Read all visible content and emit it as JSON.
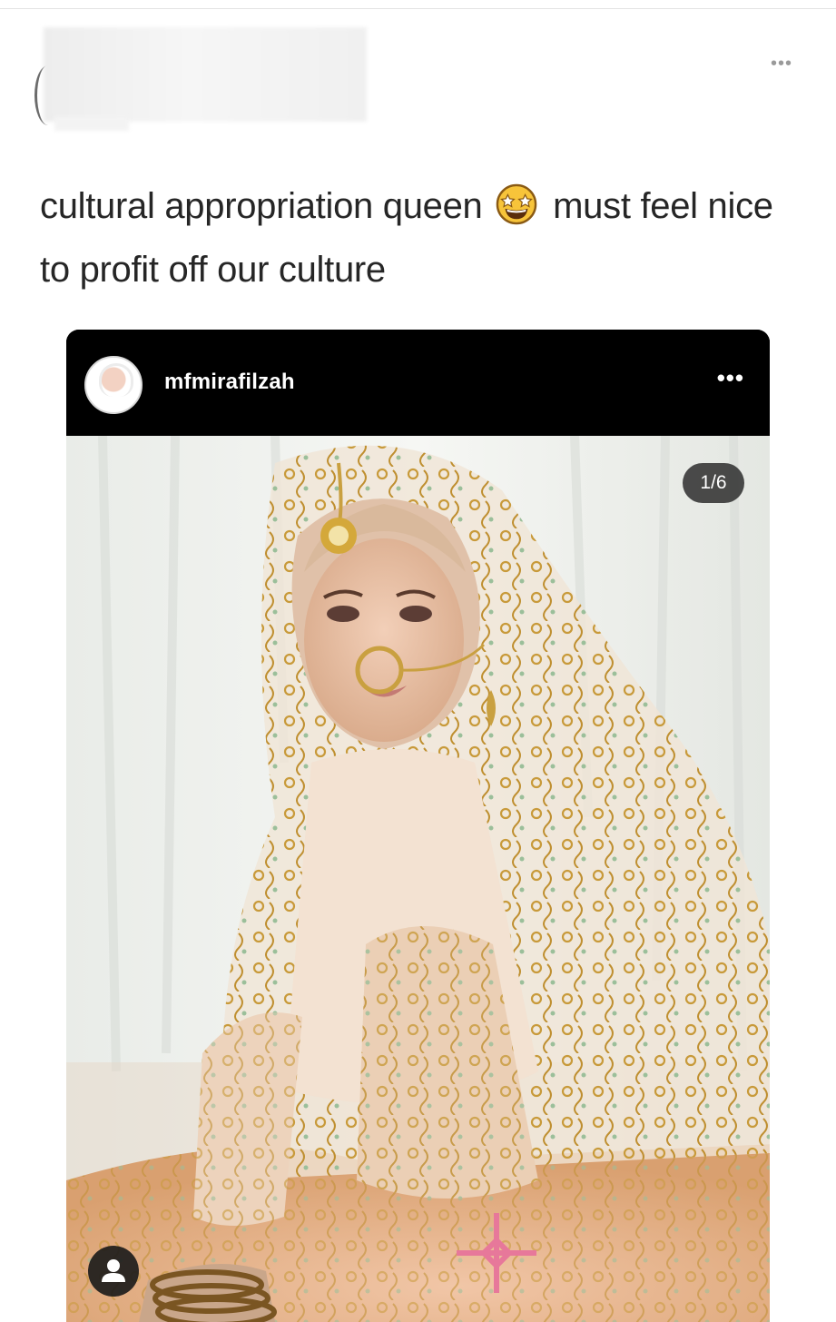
{
  "tweet": {
    "more_menu": "•••",
    "caption_part1": "cultural appropriation queen",
    "emoji": "star-struck-emoji",
    "caption_part2": "must feel nice to profit off our culture"
  },
  "instagram_post": {
    "username": "mfmirafilzah",
    "more_menu": "•••",
    "counter": "1/6",
    "icons": {
      "avatar": "profile-avatar",
      "tag": "person-tag-icon"
    }
  },
  "colors": {
    "post_header_bg": "#000000",
    "caption_text": "#262626",
    "counter_bg": "#2d2d2d"
  }
}
